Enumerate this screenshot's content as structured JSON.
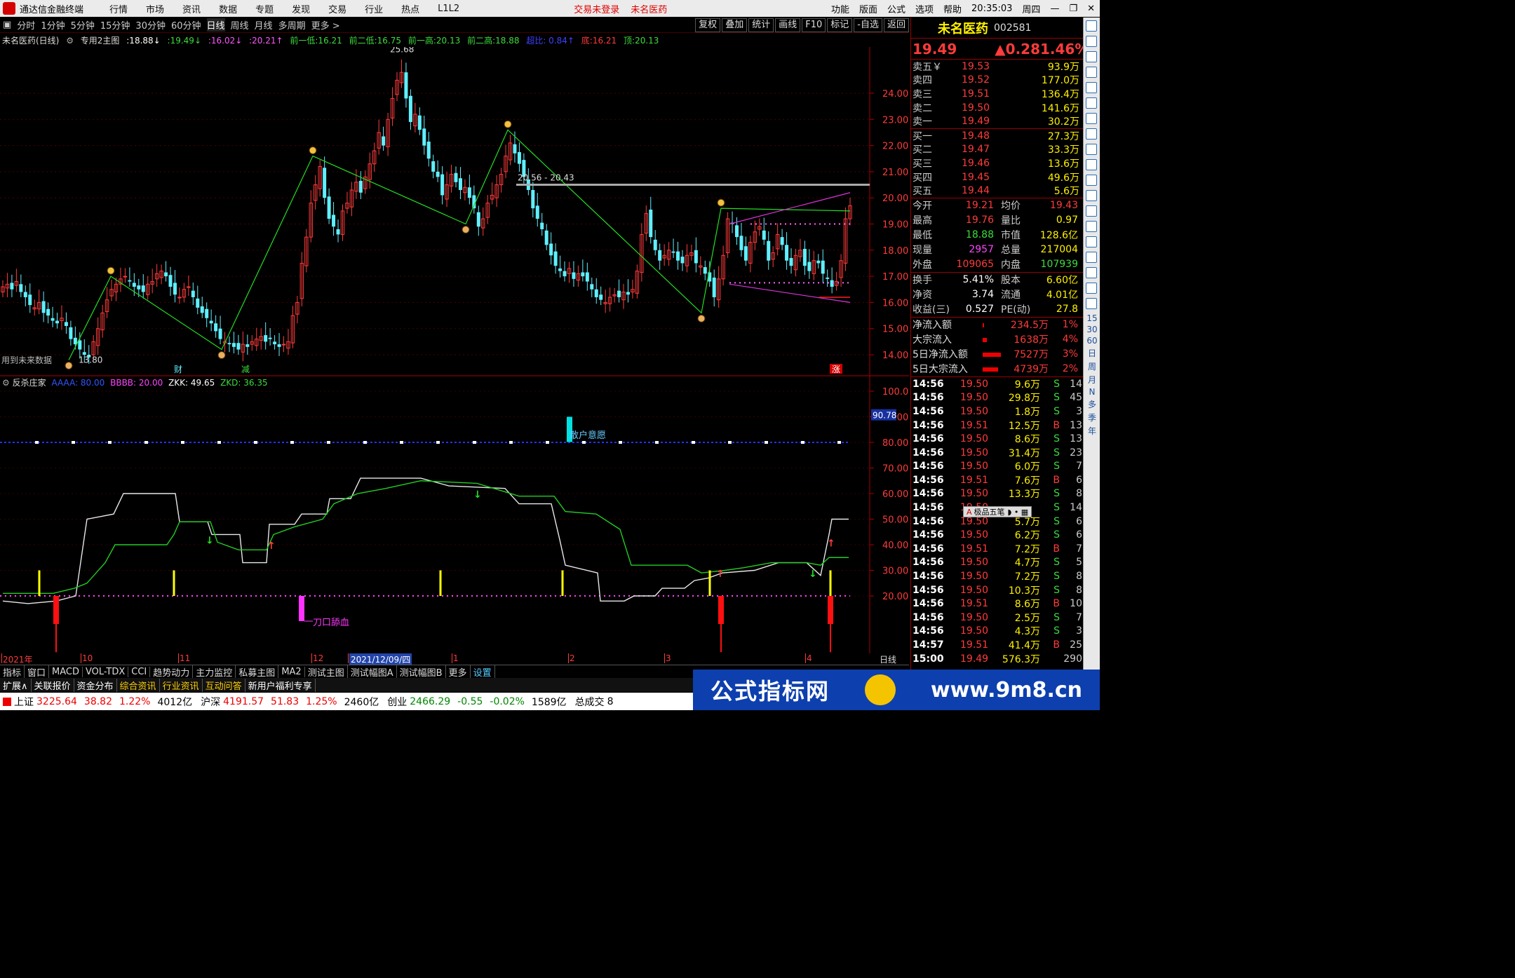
{
  "app": {
    "title": "通达信金融终端",
    "menu": [
      "行情",
      "市场",
      "资讯",
      "数据",
      "专题",
      "发现",
      "交易",
      "行业",
      "热点",
      "L1L2"
    ],
    "login_status": "交易未登录",
    "stock_name_top": "未名医药",
    "right_menu": [
      "功能",
      "版面",
      "公式",
      "选项",
      "帮助"
    ],
    "clock": "20:35:03",
    "weekday": "周四"
  },
  "periods": {
    "items": [
      "分时",
      "1分钟",
      "5分钟",
      "15分钟",
      "30分钟",
      "60分钟",
      "日线",
      "周线",
      "月线",
      "多周期",
      "更多 >"
    ],
    "active": "日线",
    "tools": [
      "复权",
      "叠加",
      "统计",
      "画线",
      "F10",
      "标记",
      "-自选",
      "返回"
    ]
  },
  "infobar": {
    "label": "未名医药(日线)",
    "indicator": "专用2主图",
    "v1": ":18.88↓",
    "v2": ":19.49↓",
    "v3": ":16.02↓",
    "v4": ":20.21↑",
    "d1": "前一低:16.21",
    "d2": "前二低:16.75",
    "d3": "前一高:20.13",
    "d4": "前二高:18.88",
    "d5": "超比: 0.84↑",
    "d6": "底:16.21",
    "d7": "顶:20.13"
  },
  "main_chart": {
    "y_ticks": [
      "24.00",
      "23.00",
      "22.00",
      "21.00",
      "20.00",
      "19.00",
      "18.00",
      "17.00",
      "16.00",
      "15.00",
      "14.00"
    ],
    "ylim": [
      13.6,
      25.8
    ],
    "high_label": "25.68",
    "low_label": "13.80",
    "range_label": "20.56 - 20.43",
    "note": "用到未来数据",
    "tags": [
      "财",
      "减",
      "涨"
    ]
  },
  "ind2": {
    "name": "反杀庄家",
    "AAAA": "AAAA: 80.00",
    "BBBB": "BBBB: 20.00",
    "ZKK": "ZKK: 49.65",
    "ZKD": "ZKD: 36.35",
    "y_ticks": [
      "100.0",
      "90.00",
      "80.00",
      "70.00",
      "60.00",
      "50.00",
      "40.00",
      "30.00",
      "20.00"
    ],
    "cursor_value": "90.78",
    "label1": "散户意愿",
    "label2": "刀口舔血"
  },
  "xaxis": {
    "labels": [
      "2021年",
      "10",
      "11",
      "12",
      "2021/12/09/四",
      "1",
      "2",
      "3",
      "4"
    ],
    "period": "日线"
  },
  "tabs1": [
    "指标",
    "窗口",
    "MACD",
    "VOL-TDX",
    "CCI",
    "趋势动力",
    "主力监控",
    "私募主图",
    "MA2",
    "测试主图",
    "测试幅图A",
    "测试幅图B",
    "更多",
    "设置"
  ],
  "tabs2": [
    "扩展∧",
    "关联报价",
    "资金分布",
    "综合资讯",
    "行业资讯",
    "互动问答",
    "新用户福利专享"
  ],
  "quote": {
    "name": "未名医药",
    "code": "002581",
    "price": "19.49",
    "change": "▲0.28",
    "pct": "1.46%",
    "asks": [
      [
        "卖五￥",
        "19.53",
        "93.9万"
      ],
      [
        "卖四",
        "19.52",
        "177.0万"
      ],
      [
        "卖三",
        "19.51",
        "136.4万"
      ],
      [
        "卖二",
        "19.50",
        "141.6万"
      ],
      [
        "卖一",
        "19.49",
        "30.2万"
      ]
    ],
    "bids": [
      [
        "买一",
        "19.48",
        "27.3万"
      ],
      [
        "买二",
        "19.47",
        "33.3万"
      ],
      [
        "买三",
        "19.46",
        "13.6万"
      ],
      [
        "买四",
        "19.45",
        "49.6万"
      ],
      [
        "买五",
        "19.44",
        "5.6万"
      ]
    ],
    "stats": [
      [
        "今开",
        "19.21",
        "均价",
        "19.43"
      ],
      [
        "最高",
        "19.76",
        "量比",
        "0.97"
      ],
      [
        "最低",
        "18.88",
        "市值",
        "128.6亿"
      ],
      [
        "现量",
        "2957",
        "总量",
        "217004"
      ],
      [
        "外盘",
        "109065",
        "内盘",
        "107939"
      ]
    ],
    "stats2": [
      [
        "换手",
        "5.41%",
        "股本",
        "6.60亿"
      ],
      [
        "净资",
        "3.74",
        "流通",
        "4.01亿"
      ],
      [
        "收益(三)",
        "0.527",
        "PE(动)",
        "27.8"
      ]
    ],
    "flows": [
      [
        "净流入额",
        "234.5万",
        "1%"
      ],
      [
        "大宗流入",
        "1638万",
        "4%"
      ],
      [
        "5日净流入额",
        "7527万",
        "3%"
      ],
      [
        "5日大宗流入",
        "4739万",
        "2%"
      ]
    ],
    "ticks": [
      [
        "14:56",
        "19.50",
        "9.6万",
        "S",
        "14"
      ],
      [
        "14:56",
        "19.50",
        "29.8万",
        "S",
        "45"
      ],
      [
        "14:56",
        "19.50",
        "1.8万",
        "S",
        "3"
      ],
      [
        "14:56",
        "19.51",
        "12.5万",
        "B",
        "13"
      ],
      [
        "14:56",
        "19.50",
        "8.6万",
        "S",
        "13"
      ],
      [
        "14:56",
        "19.50",
        "31.4万",
        "S",
        "23"
      ],
      [
        "14:56",
        "19.50",
        "6.0万",
        "S",
        "7"
      ],
      [
        "14:56",
        "19.51",
        "7.6万",
        "B",
        "6"
      ],
      [
        "14:56",
        "19.50",
        "13.3万",
        "S",
        "8"
      ],
      [
        "14:56",
        "19.50",
        "",
        "S",
        "14"
      ],
      [
        "14:56",
        "19.50",
        "5.7万",
        "S",
        "6"
      ],
      [
        "14:56",
        "19.50",
        "6.2万",
        "S",
        "6"
      ],
      [
        "14:56",
        "19.51",
        "7.2万",
        "B",
        "7"
      ],
      [
        "14:56",
        "19.50",
        "4.7万",
        "S",
        "5"
      ],
      [
        "14:56",
        "19.50",
        "7.2万",
        "S",
        "8"
      ],
      [
        "14:56",
        "19.50",
        "10.3万",
        "S",
        "8"
      ],
      [
        "14:56",
        "19.51",
        "8.6万",
        "B",
        "10"
      ],
      [
        "14:56",
        "19.50",
        "2.5万",
        "S",
        "7"
      ],
      [
        "14:56",
        "19.50",
        "4.3万",
        "S",
        "3"
      ],
      [
        "14:57",
        "19.51",
        "41.4万",
        "B",
        "25"
      ],
      [
        "15:00",
        "19.49",
        "576.3万",
        "",
        "290"
      ]
    ],
    "ime": "极品五笔"
  },
  "iconstrip": {
    "labels": [
      "15",
      "30",
      "60",
      "日",
      "周",
      "月",
      "N",
      "多",
      "季",
      "年"
    ]
  },
  "status": {
    "sh": "上证",
    "sh_v": "3225.64",
    "sh_c": "38.82",
    "sh_p": "1.22%",
    "sh_a": "4012亿",
    "hs": "沪深",
    "hs_v": "4191.57",
    "hs_c": "51.83",
    "hs_p": "1.25%",
    "hs_a": "2460亿",
    "cy": "创业",
    "cy_v": "2466.29",
    "cy_c": "-0.55",
    "cy_p": "-0.02%",
    "cy_a": "1589亿",
    "total": "总成交",
    "total_v": "8"
  },
  "banner": {
    "t1": "公式指标网",
    "t2": "www.9m8.cn"
  }
}
